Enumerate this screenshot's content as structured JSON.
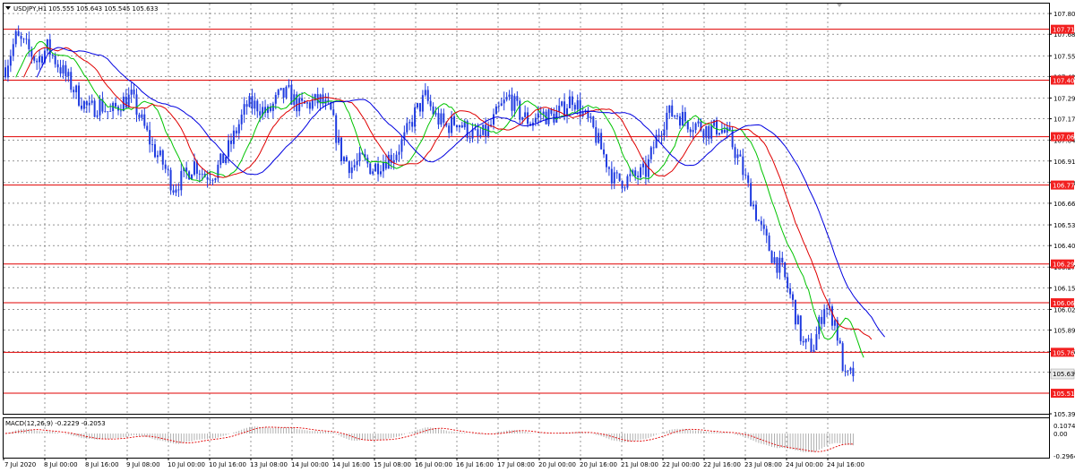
{
  "chart_data": {
    "type": "candlestick",
    "symbol_header": "USDJPY,H1",
    "ohlc_readout": "105.555 105.643 105.545 105.633",
    "y_axis": {
      "ylim": [
        105.39,
        107.8
      ],
      "tick_values": [
        107.805,
        107.68,
        107.55,
        107.425,
        107.295,
        107.17,
        107.04,
        106.915,
        106.785,
        106.66,
        106.53,
        106.405,
        106.275,
        106.15,
        106.02,
        105.895,
        105.765,
        105.64,
        105.39
      ],
      "tick_labels": [
        "107.805",
        "107.680",
        "107.550",
        "107.425",
        "107.295",
        "107.170",
        "107.040",
        "106.915",
        "106.785",
        "106.660",
        "106.530",
        "106.405",
        "106.275",
        "106.150",
        "106.020",
        "105.895",
        "105.765",
        "105.640",
        "105.390"
      ]
    },
    "current_price": {
      "value": 105.633,
      "label": "105.633"
    },
    "levels": [
      {
        "value": 107.71,
        "label": "107.710"
      },
      {
        "value": 107.403,
        "label": "107.403"
      },
      {
        "value": 107.062,
        "label": "107.062"
      },
      {
        "value": 106.77,
        "label": "106.770"
      },
      {
        "value": 106.294,
        "label": "106.294"
      },
      {
        "value": 106.06,
        "label": "106.060"
      },
      {
        "value": 105.761,
        "label": "105.761"
      },
      {
        "value": 105.514,
        "label": "105.514"
      }
    ],
    "x_labels": [
      "7 Jul 2020",
      "8 Jul 00:00",
      "8 Jul 16:00",
      "9 Jul 08:00",
      "10 Jul 00:00",
      "10 Jul 16:00",
      "13 Jul 08:00",
      "14 Jul 00:00",
      "14 Jul 16:00",
      "15 Jul 08:00",
      "16 Jul 00:00",
      "16 Jul 16:00",
      "17 Jul 08:00",
      "20 Jul 00:00",
      "20 Jul 16:00",
      "21 Jul 08:00",
      "22 Jul 00:00",
      "22 Jul 16:00",
      "23 Jul 08:00",
      "24 Jul 00:00",
      "24 Jul 16:00"
    ],
    "price_path": [
      [
        0,
        107.48
      ],
      [
        4,
        107.66
      ],
      [
        8,
        107.6
      ],
      [
        12,
        107.52
      ],
      [
        16,
        107.6
      ],
      [
        20,
        107.5
      ],
      [
        24,
        107.4
      ],
      [
        28,
        107.3
      ],
      [
        32,
        107.22
      ],
      [
        36,
        107.26
      ],
      [
        40,
        107.2
      ],
      [
        44,
        107.27
      ],
      [
        48,
        107.3
      ],
      [
        52,
        107.15
      ],
      [
        56,
        107.0
      ],
      [
        60,
        106.9
      ],
      [
        64,
        106.76
      ],
      [
        68,
        106.82
      ],
      [
        72,
        106.9
      ],
      [
        76,
        106.83
      ],
      [
        80,
        106.85
      ],
      [
        84,
        106.95
      ],
      [
        88,
        107.1
      ],
      [
        92,
        107.25
      ],
      [
        96,
        107.25
      ],
      [
        100,
        107.2
      ],
      [
        104,
        107.3
      ],
      [
        108,
        107.32
      ],
      [
        112,
        107.24
      ],
      [
        116,
        107.26
      ],
      [
        120,
        107.28
      ],
      [
        124,
        107.2
      ],
      [
        128,
        106.95
      ],
      [
        132,
        106.88
      ],
      [
        136,
        106.92
      ],
      [
        140,
        106.87
      ],
      [
        144,
        106.92
      ],
      [
        148,
        106.95
      ],
      [
        152,
        107.05
      ],
      [
        156,
        107.2
      ],
      [
        160,
        107.3
      ],
      [
        164,
        107.18
      ],
      [
        168,
        107.12
      ],
      [
        172,
        107.16
      ],
      [
        176,
        107.1
      ],
      [
        180,
        107.05
      ],
      [
        184,
        107.1
      ],
      [
        188,
        107.22
      ],
      [
        192,
        107.3
      ],
      [
        196,
        107.2
      ],
      [
        200,
        107.15
      ],
      [
        204,
        107.2
      ],
      [
        208,
        107.18
      ],
      [
        212,
        107.22
      ],
      [
        216,
        107.3
      ],
      [
        220,
        107.2
      ],
      [
        224,
        107.1
      ],
      [
        228,
        106.95
      ],
      [
        232,
        106.8
      ],
      [
        236,
        106.8
      ],
      [
        240,
        106.82
      ],
      [
        244,
        106.85
      ],
      [
        248,
        107.05
      ],
      [
        252,
        107.2
      ],
      [
        256,
        107.2
      ],
      [
        260,
        107.15
      ],
      [
        264,
        107.13
      ],
      [
        268,
        107.1
      ],
      [
        272,
        107.12
      ],
      [
        276,
        107.05
      ],
      [
        280,
        106.9
      ],
      [
        284,
        106.7
      ],
      [
        288,
        106.5
      ],
      [
        292,
        106.35
      ],
      [
        296,
        106.25
      ],
      [
        300,
        106.05
      ],
      [
        304,
        105.8
      ],
      [
        308,
        105.8
      ],
      [
        312,
        106.05
      ],
      [
        316,
        105.95
      ],
      [
        320,
        105.6
      ],
      [
        323,
        105.633
      ]
    ],
    "ma_series": [
      {
        "color": "#00c400",
        "period": 8
      },
      {
        "color": "#e00000",
        "period": 14
      },
      {
        "color": "#0000e0",
        "period": 24
      }
    ],
    "macd": {
      "label": "MACD(12,26,9) -0.2229 -0.2053",
      "ylim": [
        -0.2964,
        0.1074
      ],
      "tick_values": [
        0.1074,
        0.0,
        -0.2964
      ],
      "tick_labels": [
        "0.1074",
        "0.00",
        "-0.2964"
      ]
    },
    "grid": true
  },
  "colors": {
    "level_line": "#e10000",
    "level_label_bg": "#f22020",
    "candle": "#1f3be0",
    "grid": "#555555",
    "current_price_box": "#e9e9e9",
    "macd_signal": "#e10000",
    "macd_hist": "#a9a9a9"
  }
}
